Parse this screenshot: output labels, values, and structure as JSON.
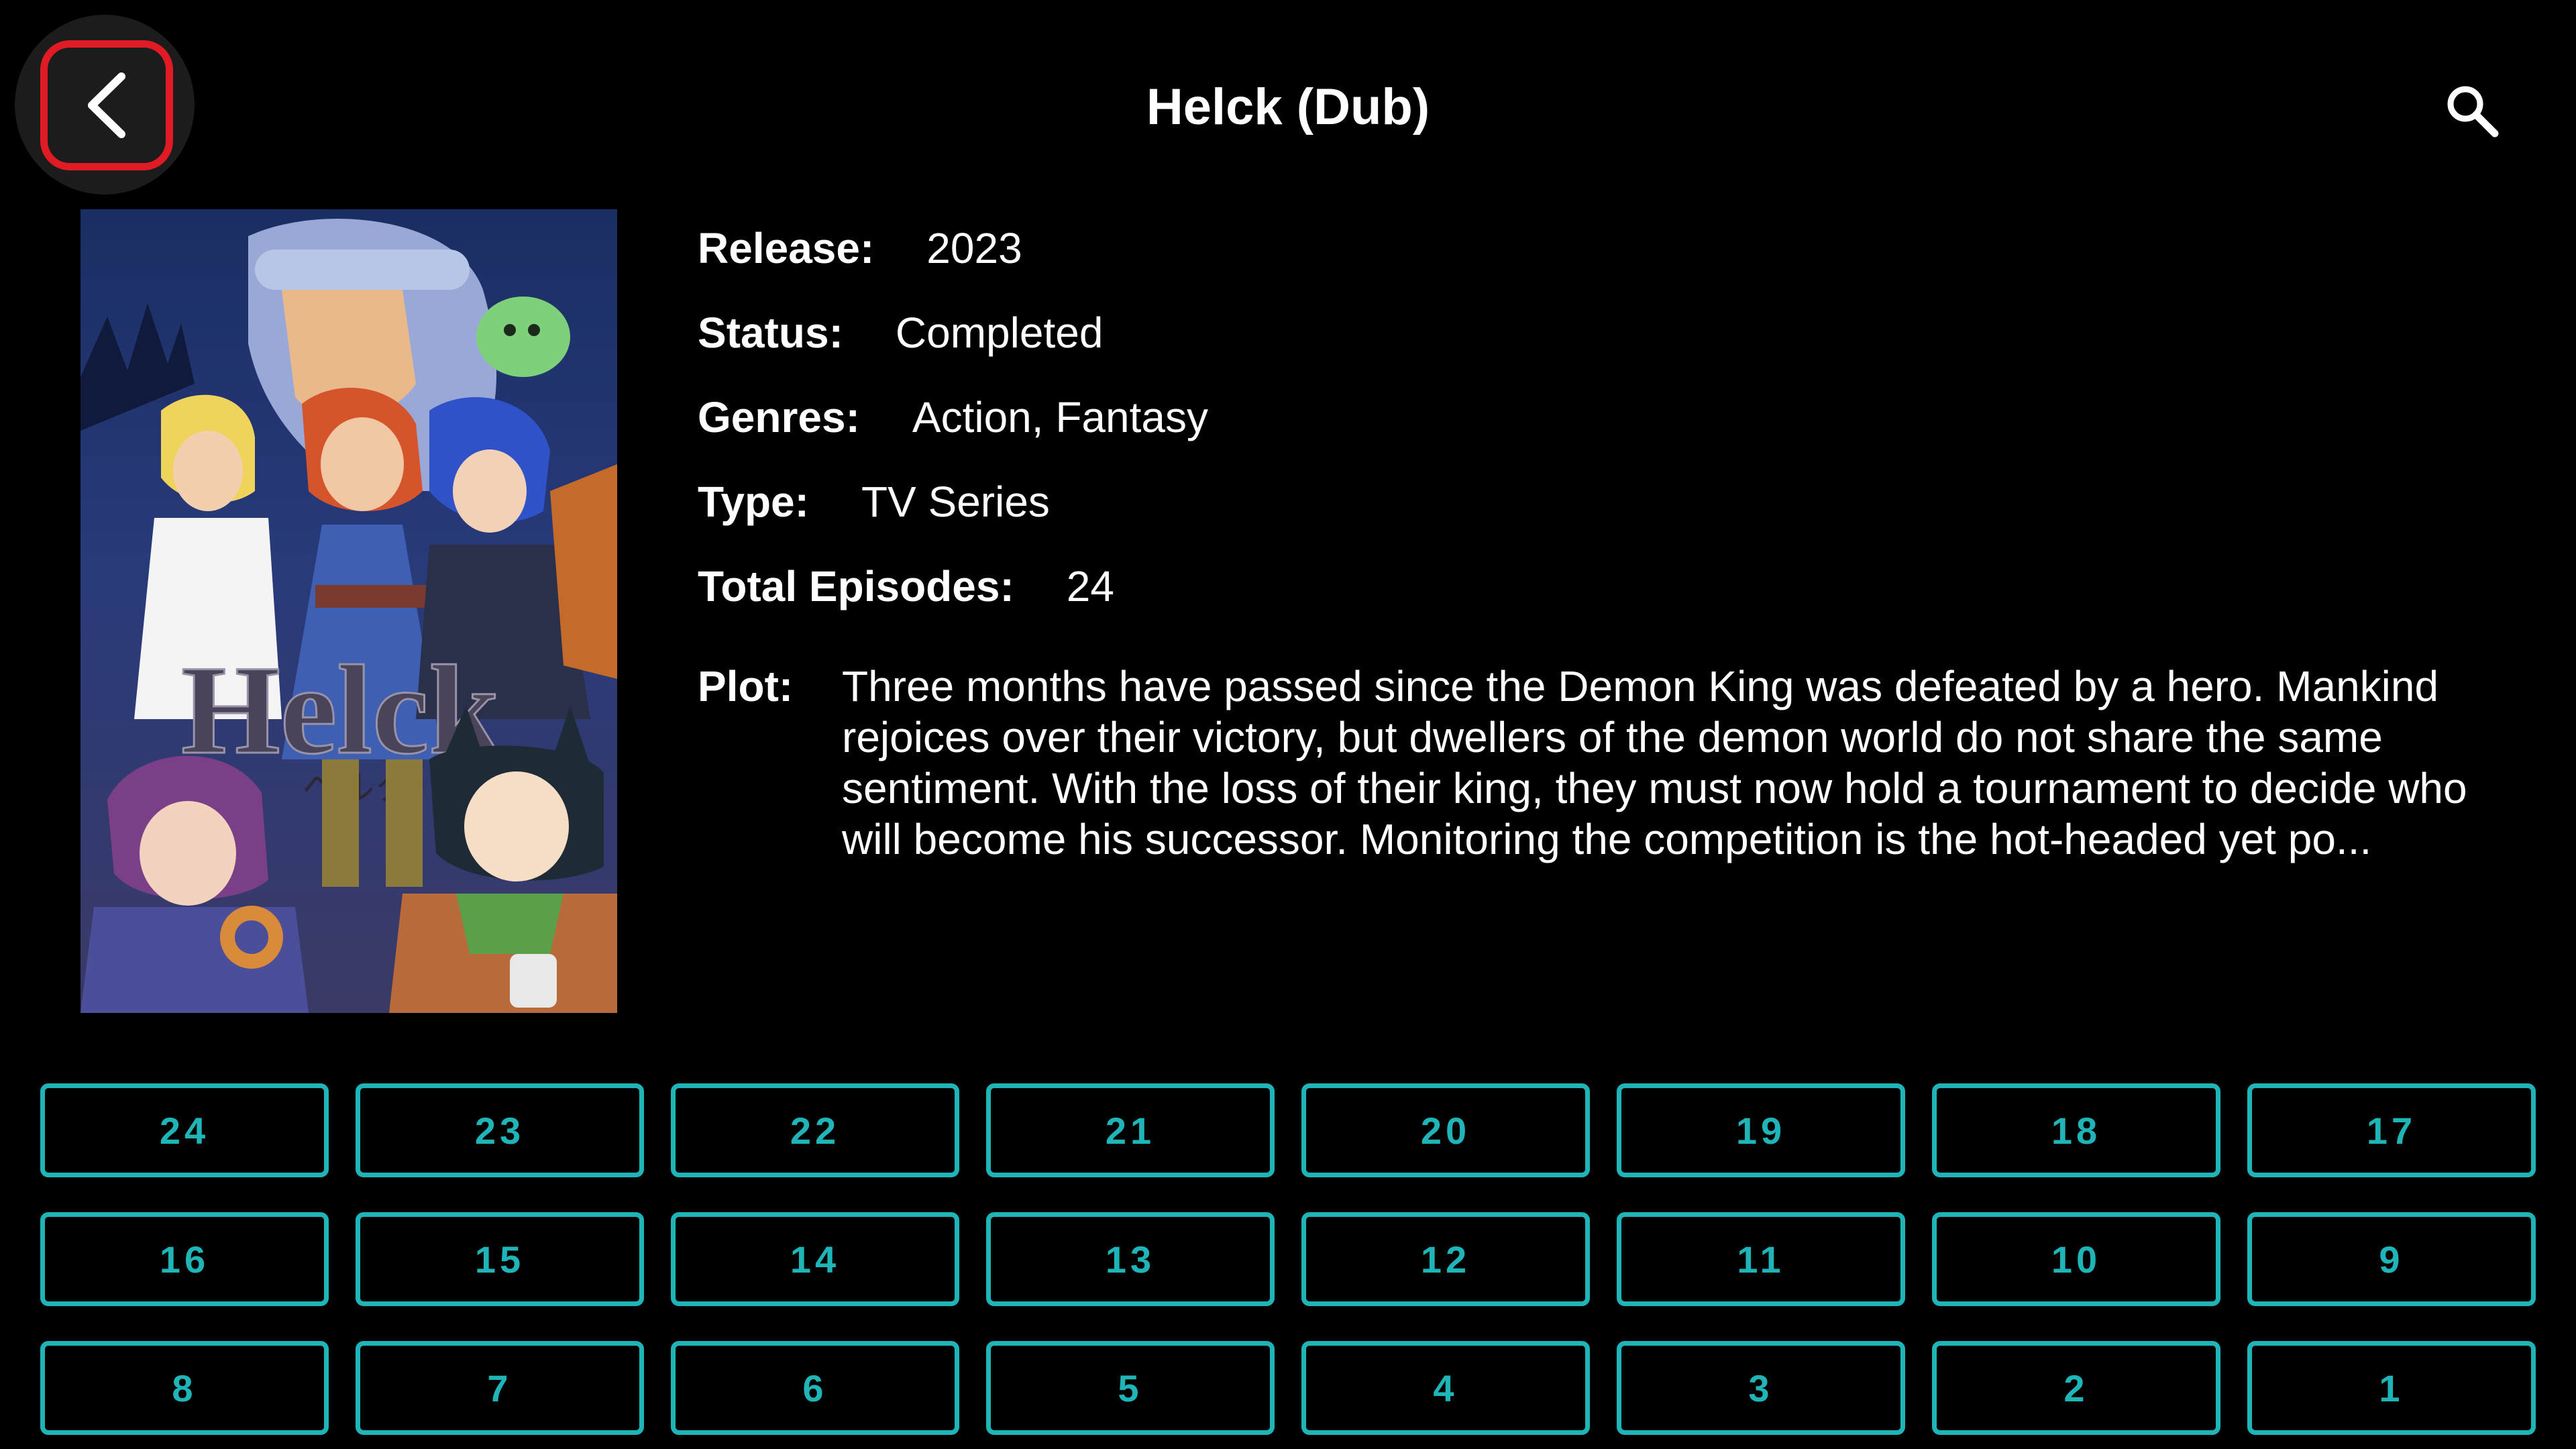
{
  "header": {
    "title": "Helck (Dub)",
    "back_icon": "chevron-left-icon",
    "search_icon": "search-icon",
    "focus_color": "#e01b24"
  },
  "poster": {
    "logo_text": "Helck",
    "logo_sub": "ヘルク"
  },
  "details": {
    "release_label": "Release:",
    "release_value": "2023",
    "status_label": "Status:",
    "status_value": "Completed",
    "genres_label": "Genres:",
    "genres_value": "Action, Fantasy",
    "type_label": "Type:",
    "type_value": "TV Series",
    "episodes_label": "Total Episodes:",
    "episodes_value": "24",
    "plot_label": "Plot:",
    "plot_value": "Three months have passed since the Demon King was defeated by a hero. Mankind rejoices over their victory, but dwellers of the demon world do not share the same sentiment. With the loss of their king, they must now hold a tournament to decide who will become his successor. Monitoring the competition is the hot-headed yet po..."
  },
  "episodes": [
    "24",
    "23",
    "22",
    "21",
    "20",
    "19",
    "18",
    "17",
    "16",
    "15",
    "14",
    "13",
    "12",
    "11",
    "10",
    "9",
    "8",
    "7",
    "6",
    "5",
    "4",
    "3",
    "2",
    "1"
  ],
  "accent_color": "#1fb5b8"
}
